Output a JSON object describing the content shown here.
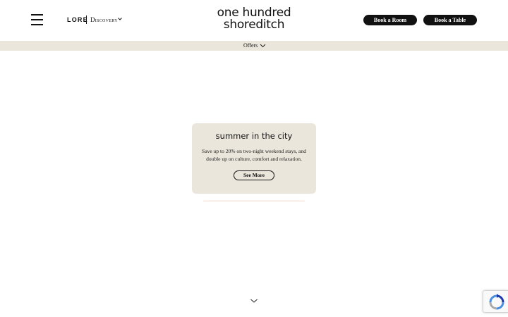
{
  "header": {
    "menu_icon": "hamburger-icon",
    "lore_label": "LORE",
    "discovery_label": "Discovery",
    "discovery_chevron_icon": "chevron-down-icon",
    "brand_line1": "one hundred",
    "brand_line2": "shoreditch",
    "book_room_label": "Book a Room",
    "book_table_label": "Book a Table"
  },
  "offers_bar": {
    "label": "Offers",
    "chevron_icon": "chevron-down-icon",
    "background": "#ebe6dc"
  },
  "promo_card": {
    "title": "summer in the city",
    "text": "Save up to 20% on two-night weekend stays, and double up on culture, comfort and relaxation.",
    "button_label": "See More",
    "background": "#ebe6dc"
  },
  "scroll_indicator": {
    "icon": "chevron-down-icon"
  },
  "recaptcha": {
    "icon": "recaptcha-icon"
  },
  "colors": {
    "text": "#111111",
    "button_bg": "#111111",
    "button_text": "#ffffff"
  }
}
